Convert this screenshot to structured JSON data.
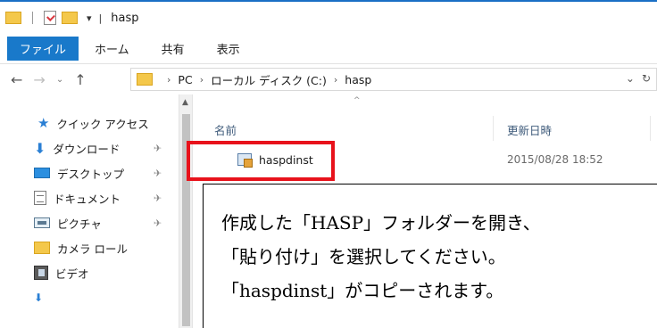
{
  "titlebar": {
    "separator": "|",
    "qat_dropdown": "▾",
    "title": "hasp"
  },
  "ribbon": {
    "tabs": [
      "ファイル",
      "ホーム",
      "共有",
      "表示"
    ]
  },
  "address_bar": {
    "back": "←",
    "forward": "→",
    "recent": "⌄",
    "up": "↑",
    "crumb_sep": "›",
    "crumbs": [
      "PC",
      "ローカル ディスク (C:)",
      "hasp"
    ],
    "dropdown": "⌄",
    "refresh": "↻"
  },
  "nav_pane": {
    "pin": "✈",
    "items": [
      {
        "label": "クイック アクセス",
        "icon": "star-icon"
      },
      {
        "label": "ダウンロード",
        "icon": "download-icon"
      },
      {
        "label": "デスクトップ",
        "icon": "desktop-icon"
      },
      {
        "label": "ドキュメント",
        "icon": "documents-icon"
      },
      {
        "label": "ピクチャ",
        "icon": "pictures-icon"
      },
      {
        "label": "カメラ ロール",
        "icon": "folder-icon"
      },
      {
        "label": "ビデオ",
        "icon": "video-icon"
      }
    ],
    "scroll_up": "▲"
  },
  "file_list": {
    "sort_indicator": "^",
    "columns": {
      "name": "名前",
      "date": "更新日時"
    },
    "files": [
      {
        "name": "haspdinst",
        "modified": "2015/08/28 18:52"
      }
    ]
  },
  "callout": {
    "lines": [
      "作成した「HASP」フォルダーを開き、",
      "「貼り付け」を選択してください。",
      "「haspdinst」がコピーされます。"
    ]
  },
  "colors": {
    "accent": "#1979ca",
    "highlight": "#e8121b"
  }
}
